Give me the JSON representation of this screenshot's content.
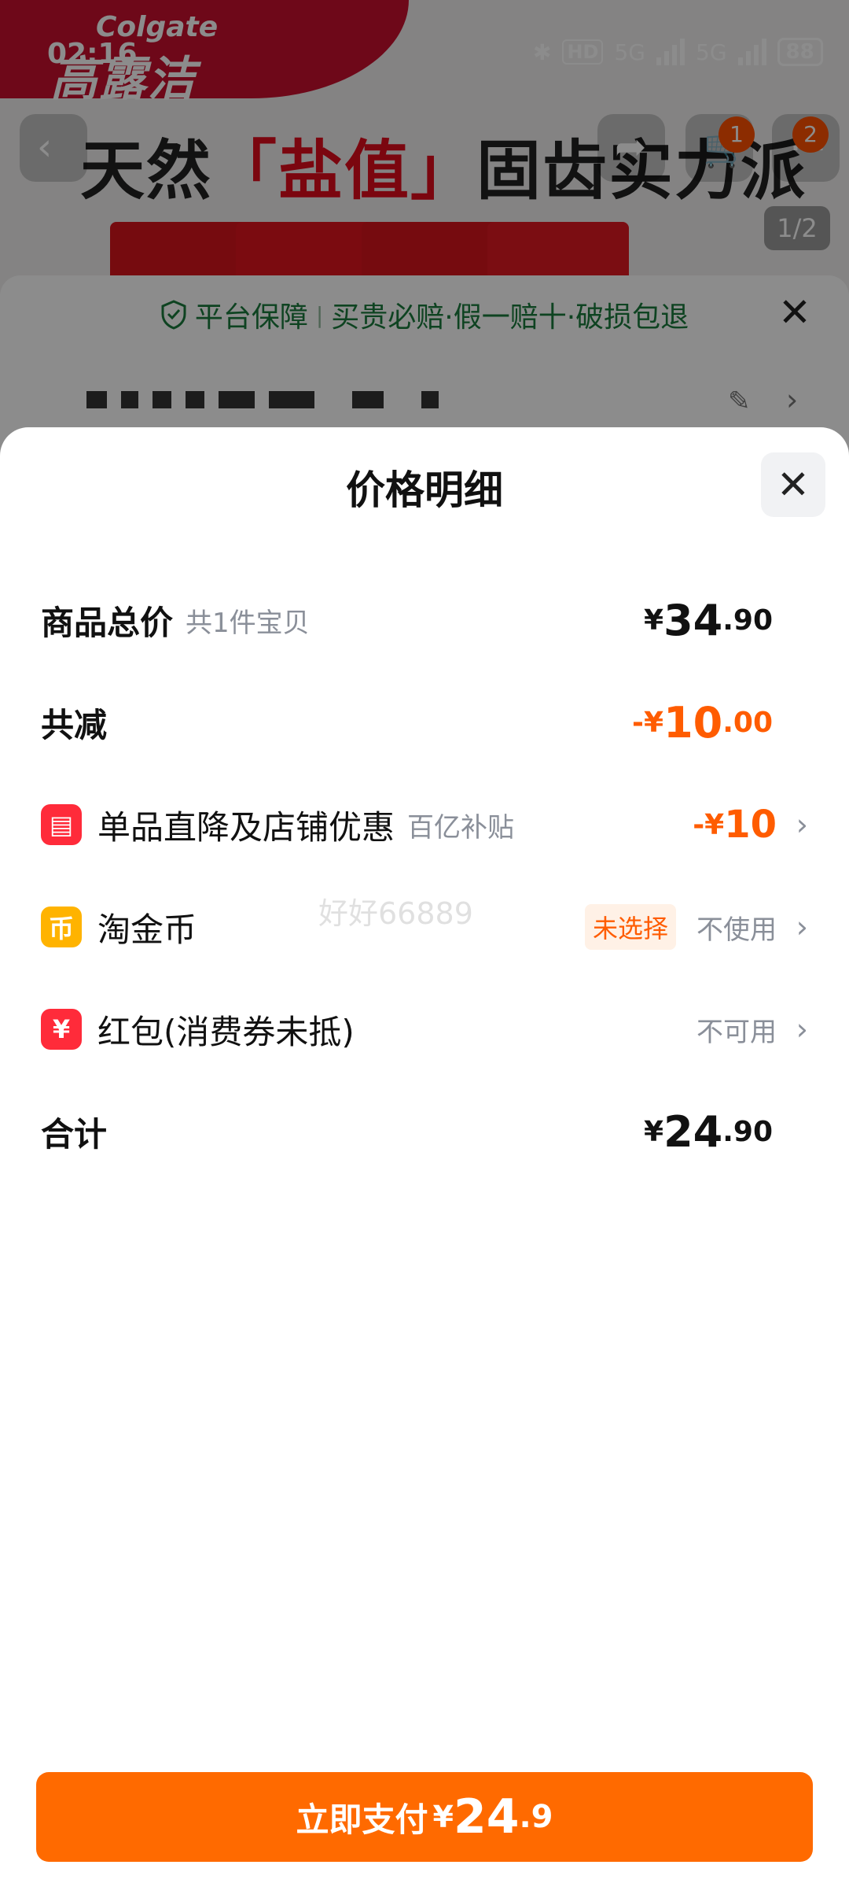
{
  "status_bar": {
    "time": "02:16",
    "hd": "HD",
    "net1": "5G",
    "net2": "5G",
    "battery": "88"
  },
  "product": {
    "brand_en": "Colgate",
    "brand_cn": "高露洁",
    "headline_pre": "天然",
    "headline_mid": "「盐值」",
    "headline_post": "固齿实力派",
    "pager": "1/2",
    "cart_badge": "1",
    "more_badge": "2"
  },
  "guarantee": {
    "part1": "平台保障",
    "part2": "买贵必赔·假一赔十·破损包退"
  },
  "sheet": {
    "title": "价格明细",
    "rows": {
      "total": {
        "label": "商品总价",
        "sub": "共1件宝贝",
        "currency": "¥",
        "int": "34",
        "dec": ".90"
      },
      "reduce": {
        "label": "共减",
        "sign": "-",
        "currency": "¥",
        "int": "10",
        "dec": ".00"
      },
      "discount": {
        "label": "单品直降及店铺优惠",
        "sub": "百亿补贴",
        "sign": "-",
        "currency": "¥",
        "int": "10"
      },
      "coin": {
        "label": "淘金币",
        "tag": "未选择",
        "value": "不使用"
      },
      "packet": {
        "label": "红包(消费券未抵)",
        "value": "不可用"
      },
      "sum": {
        "label": "合计",
        "currency": "¥",
        "int": "24",
        "dec": ".90"
      }
    },
    "watermark": "好好66889"
  },
  "pay_button": {
    "label": "立即支付",
    "currency": "¥",
    "int": "24",
    "dec": ".9"
  },
  "colors": {
    "accent": "#ff5c00",
    "pay": "#ff6a00",
    "green": "#1a7b3d"
  }
}
